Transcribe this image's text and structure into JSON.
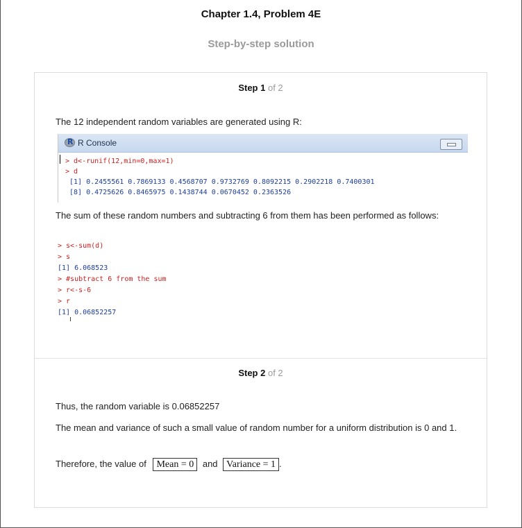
{
  "header": {
    "title": "Chapter 1.4, Problem 4E",
    "subtitle": "Step-by-step solution"
  },
  "step1": {
    "label": "Step 1",
    "of": "of 2",
    "intro": "The 12 independent random variables are generated using R:",
    "console": {
      "title": "R Console",
      "lines": [
        "> d<-runif(12,min=0,max=1)",
        "> d",
        " [1] 0.2455561 0.7869133 0.4568707 0.9732769 0.8092215 0.2902218 0.7400301",
        " [8] 0.4725626 0.8465975 0.1438744 0.0670452 0.2363526"
      ]
    },
    "para2": "The sum of these random numbers and subtracting 6 from them has been performed as follows:",
    "code_lines": [
      "> s<-sum(d)",
      "> s",
      "[1] 6.068523",
      "> #subtract 6 from the sum",
      "> r<-s-6",
      "> r",
      "[1] 0.06852257"
    ]
  },
  "step2": {
    "label": "Step 2",
    "of": "of 2",
    "line1": "Thus, the random variable is 0.06852257",
    "line2": "The mean and variance of such a small value of random number for a uniform distribution is 0 and 1.",
    "line3_prefix": "Therefore, the value of",
    "box_mean": "Mean  =  0",
    "line3_and": "and",
    "box_variance": "Variance  =  1",
    "line3_suffix": "."
  }
}
